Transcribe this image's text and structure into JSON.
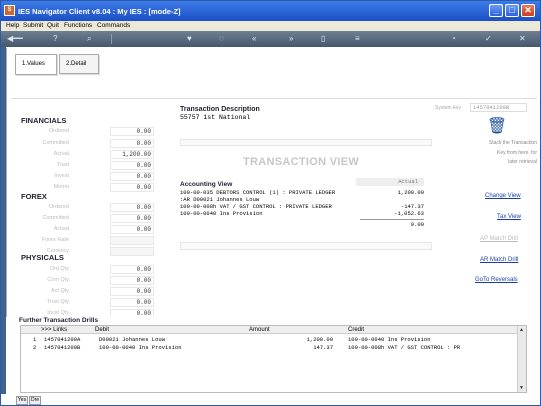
{
  "window": {
    "title": "IES Navigator Client v8.04 : My IES :        [mode-Z]"
  },
  "menu": [
    "Help",
    "Submit",
    "Quit",
    "Functions",
    "Commands"
  ],
  "tabs": [
    "1.Values",
    "2.Detail"
  ],
  "financials": {
    "heading": "FINANCIALS",
    "rows": [
      {
        "label": "Ordered",
        "value": "0.00"
      },
      {
        "label": "Committed",
        "value": "0.00"
      },
      {
        "label": "Actual",
        "value": "1,200.00"
      },
      {
        "label": "Trust",
        "value": "0.00"
      },
      {
        "label": "Invest",
        "value": "0.00"
      },
      {
        "label": "Memo",
        "value": "0.00"
      }
    ]
  },
  "forex": {
    "heading": "FOREX",
    "rows": [
      {
        "label": "Ordered",
        "value": "0.00"
      },
      {
        "label": "Committed",
        "value": "0.00"
      },
      {
        "label": "Actual",
        "value": "0.00"
      },
      {
        "label": "Forex Rate",
        "value": ""
      },
      {
        "label": "Currency",
        "value": ""
      }
    ]
  },
  "physicals": {
    "heading": "PHYSICALS",
    "rows": [
      {
        "label": "Ord Qty",
        "value": "0.00"
      },
      {
        "label": "Com Qty",
        "value": "0.00"
      },
      {
        "label": "Act Qty",
        "value": "0.00"
      },
      {
        "label": "Trust Qty",
        "value": "0.00"
      },
      {
        "label": "Invst Qty",
        "value": "0.00"
      }
    ]
  },
  "transaction": {
    "desc_label": "Transaction Description",
    "desc_value": "55757 1st National",
    "system_label": "System key",
    "system_value": "1457041200B",
    "view_title": "TRANSACTION VIEW",
    "accounting_label": "Accounting View",
    "actual_header": "Actual",
    "acc_lines": [
      {
        "text": "100-00-035 DEBTORS CONTROL (1) : PRIVATE LEDGER",
        "amount": "1,200.00"
      },
      {
        "text": ":AR  D00021 Johannes Louw",
        "amount": ""
      },
      {
        "text": "100-00-008h VAT / GST CONTROL : PRIVATE LEDGER",
        "amount": "-147.37"
      },
      {
        "text": "100-00-0040 Ins Provision",
        "amount": "-1,052.63"
      }
    ],
    "total": "0.00"
  },
  "right_panel": {
    "stack_label": "Stack the Transaction",
    "key_label": "Key from here, for",
    "later_label": "later retrieval",
    "links": [
      {
        "label": "Change View",
        "enabled": true
      },
      {
        "label": "Tax View",
        "enabled": true
      },
      {
        "label": "AP Match Drill",
        "enabled": false
      },
      {
        "label": "AR Match Drill",
        "enabled": true
      },
      {
        "label": "GoTo Reversals",
        "enabled": true
      }
    ]
  },
  "further": {
    "heading": "Further Transaction Drills",
    "columns": [
      ">>> Links",
      "Debit",
      "Amount",
      "Credit"
    ],
    "rows": [
      {
        "n": "1",
        "link": "1457041200A",
        "debit": "D00021 Johannes Louw",
        "amount": "1,200.00",
        "credit": "100-00-0040 Ins Provision"
      },
      {
        "n": "2",
        "link": "1457041200B",
        "debit": "100-00-0040 Ins Provision",
        "amount": "147.37",
        "credit": "100-00-008h VAT / GST CONTROL : PR"
      }
    ]
  },
  "footer_buttons": [
    "Yes",
    "Dre"
  ]
}
